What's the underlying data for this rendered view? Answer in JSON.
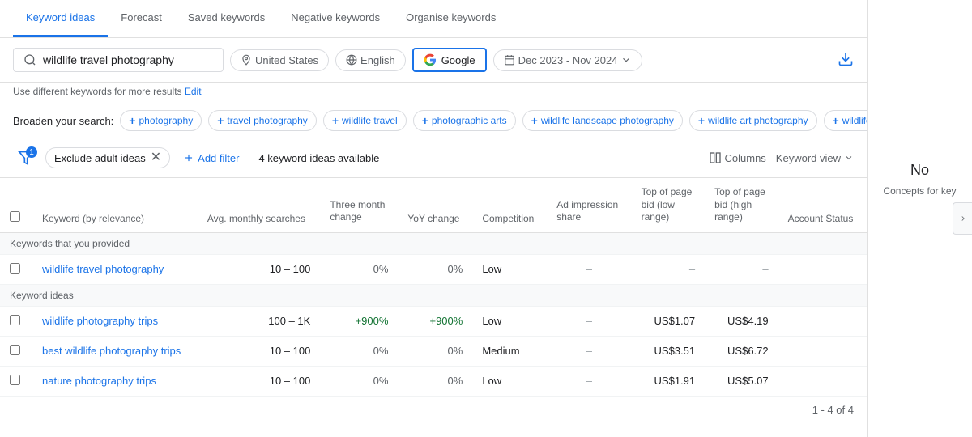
{
  "nav": {
    "tabs": [
      {
        "label": "Keyword ideas",
        "active": true
      },
      {
        "label": "Forecast",
        "active": false
      },
      {
        "label": "Saved keywords",
        "active": false
      },
      {
        "label": "Negative keywords",
        "active": false
      },
      {
        "label": "Organise keywords",
        "active": false
      }
    ]
  },
  "search": {
    "query": "wildlife travel photography",
    "location": "United States",
    "language": "English",
    "network": "Google",
    "date_range": "Dec 2023 - Nov 2024"
  },
  "hint": {
    "text": "Use different keywords for more results",
    "link": "Edit"
  },
  "broaden": {
    "label": "Broaden your search:",
    "chips": [
      "photography",
      "travel photography",
      "wildlife travel",
      "photographic arts",
      "wildlife landscape photography",
      "wildlife art photography",
      "wildlife animal photography"
    ]
  },
  "actionbar": {
    "exclude_label": "Exclude adult ideas",
    "add_filter": "Add filter",
    "ideas_count": "4 keyword ideas available",
    "columns": "Columns",
    "keyword_view": "Keyword view",
    "badge": "1"
  },
  "table": {
    "columns": [
      "Keyword (by relevance)",
      "Avg. monthly searches",
      "Three month change",
      "YoY change",
      "Competition",
      "Ad impression share",
      "Top of page bid (low range)",
      "Top of page bid (high range)",
      "Account Status"
    ],
    "section_provided": "Keywords that you provided",
    "section_ideas": "Keyword ideas",
    "rows_provided": [
      {
        "keyword": "wildlife travel photography",
        "avg_searches": "10 – 100",
        "three_month": "0%",
        "yoy": "0%",
        "competition": "Low",
        "ad_impression": "–",
        "bid_low": "–",
        "bid_high": "–",
        "account_status": ""
      }
    ],
    "rows_ideas": [
      {
        "keyword": "wildlife photography trips",
        "avg_searches": "100 – 1K",
        "three_month": "+900%",
        "yoy": "+900%",
        "competition": "Low",
        "ad_impression": "–",
        "bid_low": "US$1.07",
        "bid_high": "US$4.19",
        "account_status": ""
      },
      {
        "keyword": "best wildlife photography trips",
        "avg_searches": "10 – 100",
        "three_month": "0%",
        "yoy": "0%",
        "competition": "Medium",
        "ad_impression": "–",
        "bid_low": "US$3.51",
        "bid_high": "US$6.72",
        "account_status": ""
      },
      {
        "keyword": "nature photography trips",
        "avg_searches": "10 – 100",
        "three_month": "0%",
        "yoy": "0%",
        "competition": "Low",
        "ad_impression": "–",
        "bid_low": "US$1.91",
        "bid_high": "US$5.07",
        "account_status": ""
      }
    ]
  },
  "pagination": {
    "text": "1 - 4 of 4"
  },
  "right_panel": {
    "title": "No",
    "subtitle": "Concepts for key"
  }
}
